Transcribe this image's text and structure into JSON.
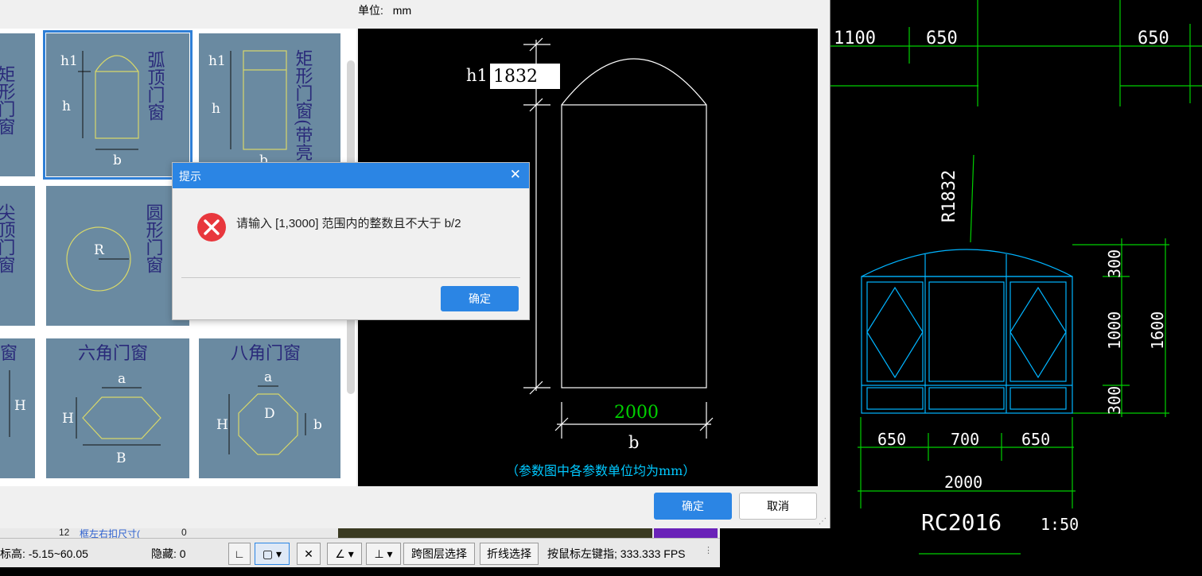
{
  "cad": {
    "top_dims": [
      "1100",
      "650",
      "650"
    ],
    "radius_label": "R1832",
    "right_dims": [
      "300",
      "1000",
      "300",
      "1600"
    ],
    "bottom_dims": [
      "650",
      "700",
      "650"
    ],
    "total_dim": "2000",
    "window_name": "RC2016",
    "scale": "1:50"
  },
  "dialog": {
    "unit_label": "单位:",
    "unit_value": "mm",
    "confirm_label": "确定",
    "cancel_label": "取消"
  },
  "tiles": [
    {
      "name": "矩形门窗"
    },
    {
      "name": "弧顶门窗",
      "labels": {
        "h1": "h1",
        "h": "h",
        "b": "b"
      }
    },
    {
      "name": "矩形门窗(带亮子)",
      "labels": {
        "h1": "h1",
        "h": "h",
        "b": "b"
      }
    },
    {
      "name": "尖顶门窗"
    },
    {
      "name": "圆形门窗",
      "labels": {
        "r": "R"
      }
    },
    {
      "name": "窗",
      "labels": {
        "h": "H"
      }
    },
    {
      "name": "六角门窗",
      "labels": {
        "a": "a",
        "h": "H",
        "b": "B"
      }
    },
    {
      "name": "八角门窗",
      "labels": {
        "a": "a",
        "h": "H",
        "d": "D",
        "b": "b"
      }
    }
  ],
  "preview": {
    "h1_label": "h1",
    "h1_value": "1832",
    "width_value": "2000",
    "width_label": "b",
    "note": "（参数图中各参数单位均为mm）"
  },
  "alert": {
    "title": "提示",
    "message": "请输入 [1,3000] 范围内的整数且不大于 b/2",
    "ok_label": "确定"
  },
  "table_fragment": {
    "row_num": "12",
    "row_text": "框左右扣尺寸(",
    "row_val": "0"
  },
  "statusbar": {
    "elevation": "标高: -5.15~60.05",
    "hidden": "隐藏: 0",
    "cross_layer": "跨图层选择",
    "polyline": "折线选择",
    "hint": "按鼠标左键指; 333.333 FPS"
  },
  "colors": {
    "accent": "#2b85e4",
    "tile": "#6a8aa1",
    "cad_green": "#00d000",
    "cad_cyan": "#00b4ff"
  }
}
